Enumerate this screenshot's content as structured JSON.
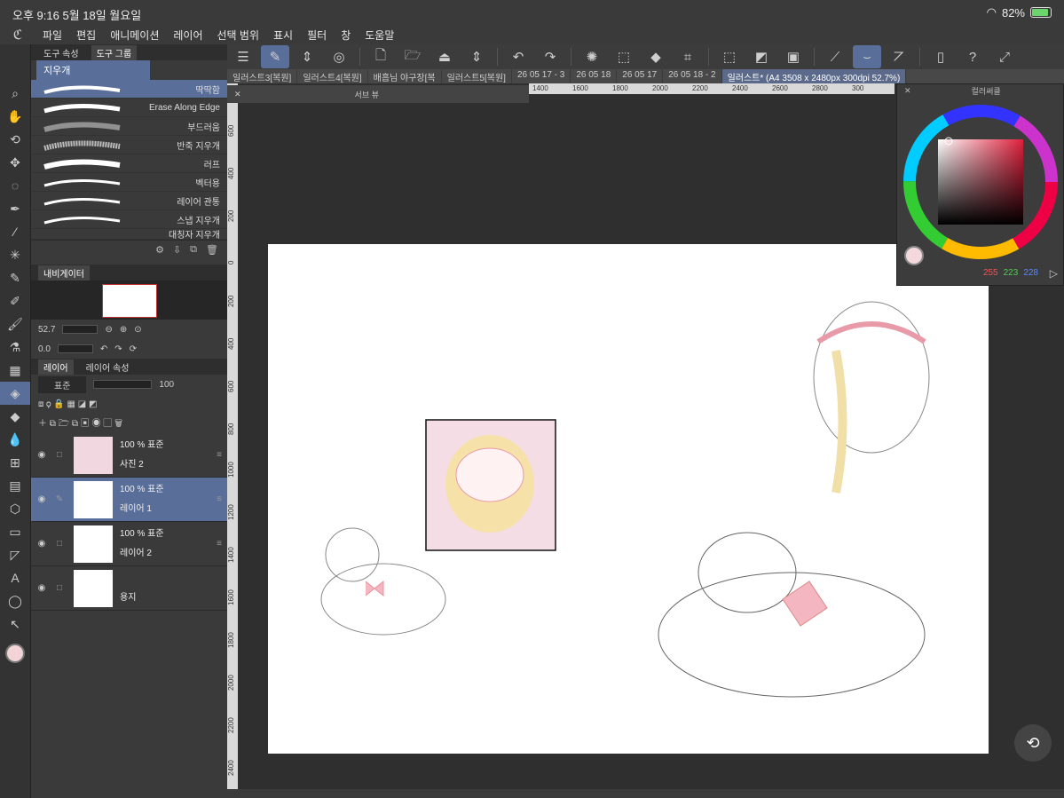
{
  "status": {
    "time": "오후 9:16",
    "date": "5월 18일 월요일",
    "battery": "82%"
  },
  "menu": [
    "파일",
    "편집",
    "애니메이션",
    "레이어",
    "선택 범위",
    "표시",
    "필터",
    "창",
    "도움말"
  ],
  "tabs": [
    "일러스트3[복원]",
    "일러스트4[복원]",
    "배흡님 야구장[복",
    "일러스트5[복원]",
    "26 05 17 - 3",
    "26 05 18",
    "26 05 17",
    "26 05 18 - 2",
    "일러스트* (A4 3508 x 2480px 300dpi 52.7%)"
  ],
  "tool_panel": {
    "tab1": "도구 속성",
    "tab2": "도구 그룹",
    "tool_name": "지우개",
    "brushes": [
      "딱딱함",
      "Erase Along Edge",
      "부드러움",
      "반죽 지우개",
      "러프",
      "벡터용",
      "레이어 관통",
      "스냅 지우개",
      "대칭자 지우개"
    ]
  },
  "navigator": {
    "title": "내비게이터",
    "zoom": "52.7",
    "rotation": "0.0"
  },
  "layers": {
    "tab1": "레이어",
    "tab2": "레이어 속성",
    "blend": "표준",
    "opacity": "100",
    "items": [
      {
        "pct": "100 % 표준",
        "name": "사진 2"
      },
      {
        "pct": "100 % 표준",
        "name": "레이어 1"
      },
      {
        "pct": "100 % 표준",
        "name": "레이어 2"
      },
      {
        "pct": "",
        "name": "용지"
      }
    ]
  },
  "subview": {
    "title": "서브 뷰"
  },
  "colorwheel": {
    "title": "컬러써클",
    "r": "255",
    "g": "223",
    "b": "228"
  },
  "ruler_top": [
    "1400",
    "1600",
    "1800",
    "2000",
    "2200",
    "2400",
    "2600",
    "2800",
    "300"
  ],
  "ruler_left": [
    "600",
    "400",
    "200",
    "0",
    "200",
    "400",
    "600",
    "800",
    "1000",
    "1200",
    "1400",
    "1600",
    "1800",
    "2000",
    "2200",
    "2400"
  ]
}
